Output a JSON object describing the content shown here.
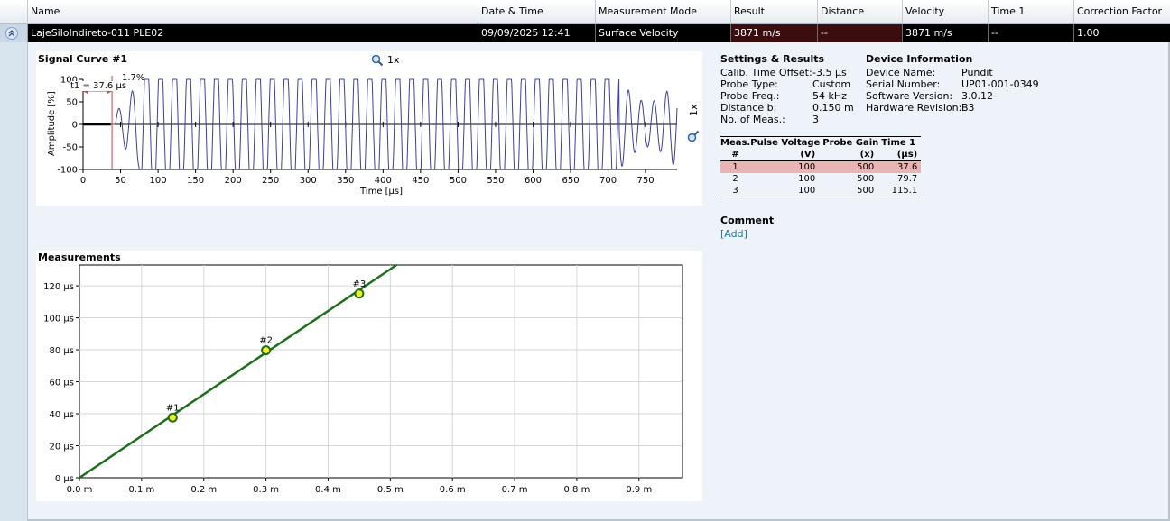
{
  "grid": {
    "columns": [
      "Name",
      "Date & Time",
      "Measurement Mode",
      "Result",
      "Distance",
      "Velocity",
      "Time 1",
      "Correction Factor"
    ],
    "row": {
      "name": "LajeSiloIndireto-011 PLE02",
      "date_time": "09/09/2025 12:41",
      "mode": "Surface Velocity",
      "result": "3871 m/s",
      "distance": "--",
      "velocity": "3871 m/s",
      "time1": "--",
      "correction_factor": "1.00"
    }
  },
  "signal_curve": {
    "title": "Signal Curve #1",
    "zoom_label": "1x",
    "zoom_label_vertical": "1x",
    "t1_label": "t1 = 37.6 µs",
    "percent_label": "1.7%",
    "ylabel": "Amplitude [%]",
    "xlabel": "Time [µs]",
    "y_ticks": [
      "100",
      "50",
      "0",
      "-50",
      "-100"
    ],
    "x_ticks": [
      "0",
      "50",
      "100",
      "150",
      "200",
      "250",
      "300",
      "350",
      "400",
      "450",
      "500",
      "550",
      "600",
      "650",
      "700",
      "750"
    ]
  },
  "settings": {
    "title": "Settings & Results",
    "rows": [
      {
        "label": "Calib. Time Offset:",
        "value": "-3.5 µs"
      },
      {
        "label": "Probe Type:",
        "value": "Custom"
      },
      {
        "label": "Probe Freq.:",
        "value": "54 kHz"
      },
      {
        "label": "Distance b:",
        "value": "0.150 m"
      },
      {
        "label": "No. of Meas.:",
        "value": "3"
      }
    ]
  },
  "device": {
    "title": "Device Information",
    "rows": [
      {
        "label": "Device Name:",
        "value": "Pundit"
      },
      {
        "label": "Serial Number:",
        "value": "UP01-001-0349"
      },
      {
        "label": "Software Version:",
        "value": "3.0.12"
      },
      {
        "label": "Hardware Revision:",
        "value": "B3"
      }
    ]
  },
  "meas_table": {
    "headers": [
      "Meas.",
      "Pulse Voltage",
      "Probe Gain",
      "Time 1"
    ],
    "subheaders": [
      "#",
      "(V)",
      "(x)",
      "(µs)"
    ],
    "rows": [
      [
        "1",
        "100",
        "500",
        "37.6"
      ],
      [
        "2",
        "100",
        "500",
        "79.7"
      ],
      [
        "3",
        "100",
        "500",
        "115.1"
      ]
    ]
  },
  "comment": {
    "title": "Comment",
    "add_label": "[Add]"
  },
  "colors": {
    "signal": "#3b3ea6",
    "marker": "#e23a3a",
    "fit_line": "#1e6e1e",
    "point_fill": "#f2ee2a",
    "row_highlight": "#e8b4b4"
  },
  "chart_data": [
    {
      "type": "line",
      "title": "Signal Curve #1",
      "xlabel": "Time [µs]",
      "ylabel": "Amplitude [%]",
      "xlim": [
        0,
        800
      ],
      "ylim": [
        -100,
        100
      ],
      "annotations": [
        "t1 = 37.6 µs",
        "1.7%"
      ],
      "series": [
        {
          "x": [
            0,
            37.6,
            50,
            60,
            75,
            90,
            100,
            750,
            760,
            770,
            780,
            790
          ],
          "y": [
            0,
            0,
            10,
            -30,
            -80,
            100,
            -100,
            -100,
            60,
            -90,
            100,
            100
          ]
        }
      ]
    },
    {
      "type": "scatter",
      "title": "Measurements",
      "xlim": [
        0,
        0.97
      ],
      "ylim": [
        0,
        133
      ],
      "x_tick_labels": [
        "0.0 m",
        "0.1 m",
        "0.2 m",
        "0.3 m",
        "0.4 m",
        "0.5 m",
        "0.6 m",
        "0.7 m",
        "0.8 m",
        "0.9 m"
      ],
      "y_tick_labels": [
        "0 µs",
        "20 µs",
        "40 µs",
        "60 µs",
        "80 µs",
        "100 µs",
        "120 µs"
      ],
      "points": [
        {
          "label": "#1",
          "x": 0.15,
          "y": 37.6
        },
        {
          "label": "#2",
          "x": 0.3,
          "y": 79.7
        },
        {
          "label": "#3",
          "x": 0.45,
          "y": 115.1
        }
      ],
      "fit_line": {
        "x": [
          0,
          0.51
        ],
        "y": [
          0,
          133
        ]
      }
    }
  ]
}
